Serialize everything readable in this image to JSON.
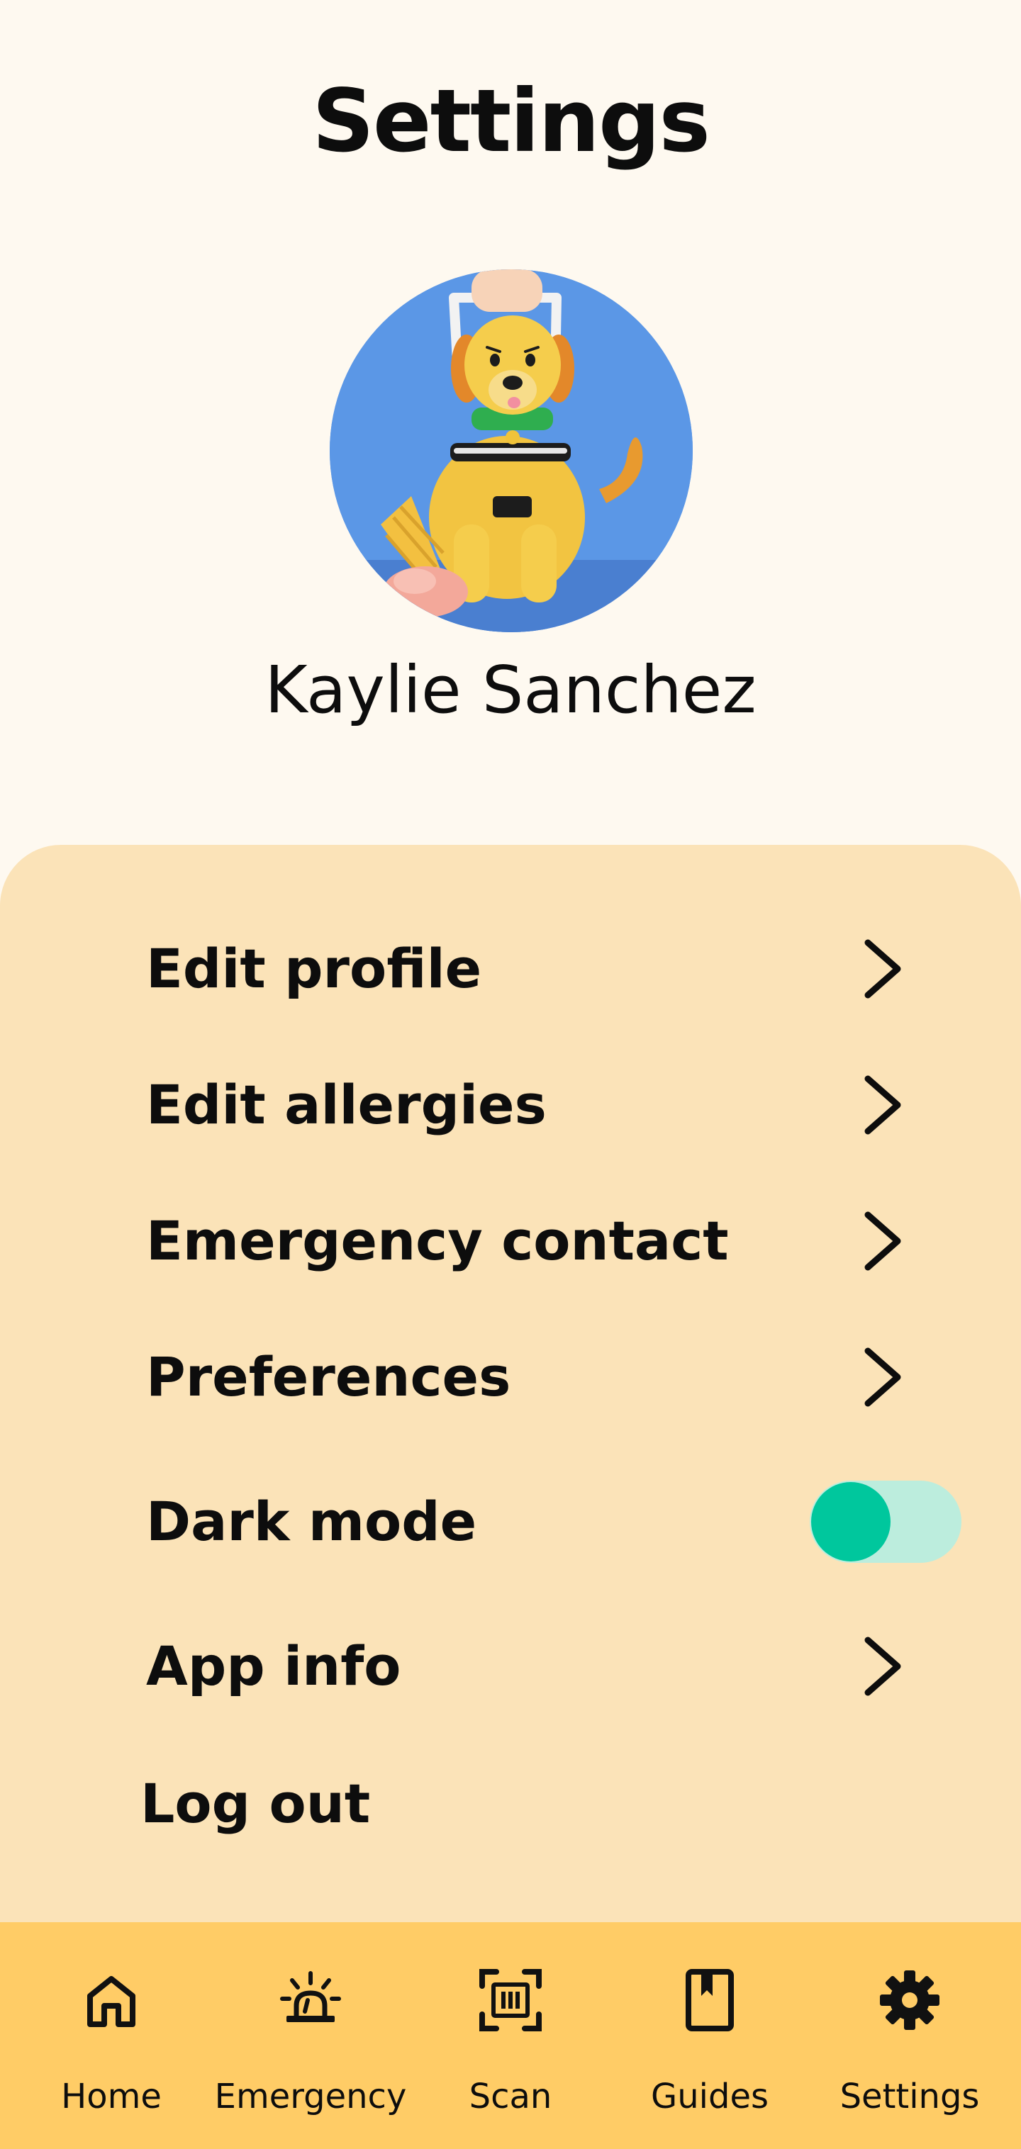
{
  "header": {
    "title": "Settings"
  },
  "profile": {
    "name": "Kaylie Sanchez",
    "avatar_icon": "dog-with-ice-cream-avatar"
  },
  "menu": {
    "edit_profile": "Edit profile",
    "edit_allergies": "Edit allergies",
    "emergency_contact": "Emergency contact",
    "preferences": "Preferences",
    "dark_mode": "Dark mode",
    "dark_mode_on": true,
    "app_info": "App info",
    "log_out": "Log out"
  },
  "nav": {
    "home": "Home",
    "emergency": "Emergency",
    "scan": "Scan",
    "guides": "Guides",
    "settings": "Settings",
    "active": "settings"
  },
  "colors": {
    "page_bg": "#fef9f0",
    "panel_bg": "#fbe3b8",
    "nav_bg": "#ffcc66",
    "toggle_track": "#bceddd",
    "toggle_knob": "#00c79d",
    "avatar_bg": "#5b97e6"
  }
}
